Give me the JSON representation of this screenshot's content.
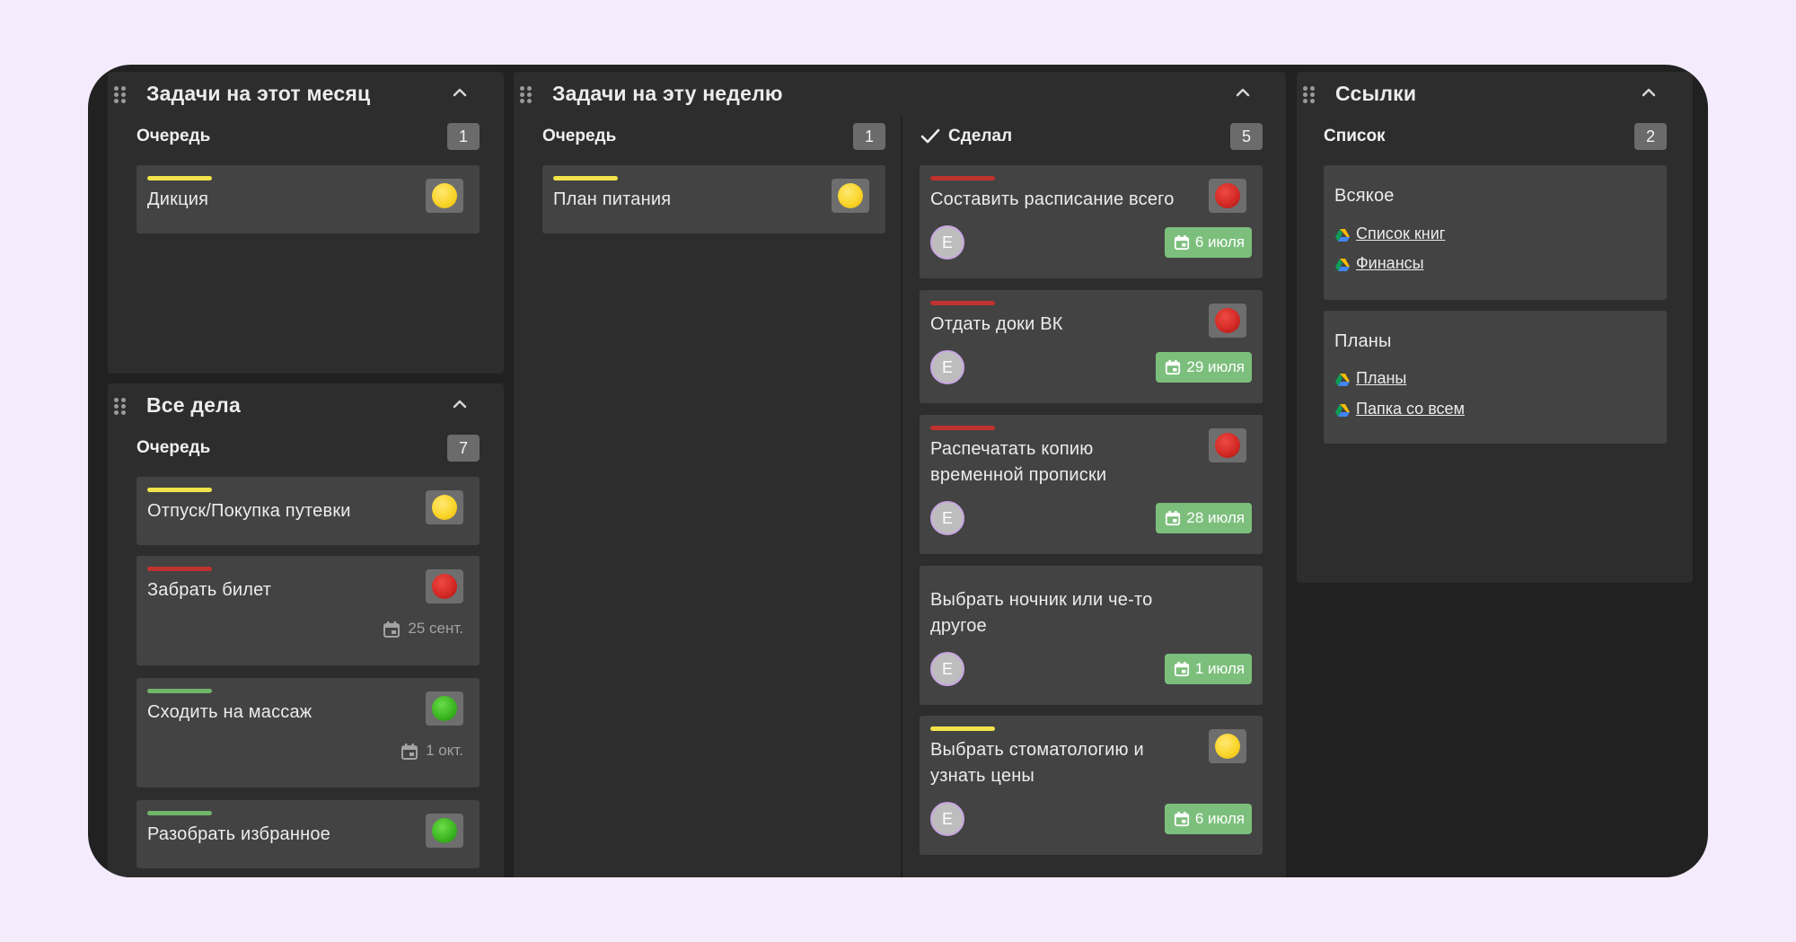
{
  "colors": {
    "page_bg": "#f4ecfd",
    "board_bg": "#212121",
    "panel_bg": "#2d2d2d",
    "card_bg": "#434343",
    "priority_yellow": "#f1e44a",
    "priority_red": "#c0322e",
    "priority_green": "#6fb66a",
    "date_badge_green": "#7cbf7c"
  },
  "panels": {
    "month": {
      "title": "Задачи на этот месяц",
      "column": {
        "title": "Очередь",
        "count": "1"
      },
      "cards": [
        {
          "title": "Дикция",
          "priority": "yellow"
        }
      ]
    },
    "all": {
      "title": "Все дела",
      "column": {
        "title": "Очередь",
        "count": "7"
      },
      "cards": [
        {
          "title": "Отпуск/Покупка путевки",
          "priority": "yellow"
        },
        {
          "title": "Забрать билет",
          "priority": "red",
          "date": "25 сент."
        },
        {
          "title": "Сходить на массаж",
          "priority": "green",
          "date": "1 окт."
        },
        {
          "title": "Разобрать избранное",
          "priority": "green"
        }
      ]
    },
    "week": {
      "title": "Задачи на эту неделю",
      "queue": {
        "title": "Очередь",
        "count": "1",
        "cards": [
          {
            "title": "План питания",
            "priority": "yellow"
          }
        ]
      },
      "done": {
        "title": "Сделал",
        "count": "5",
        "cards": [
          {
            "title": "Составить расписание всего",
            "priority": "red",
            "avatar": "E",
            "date": "6 июля"
          },
          {
            "title": "Отдать доки ВК",
            "priority": "red",
            "avatar": "E",
            "date": "29 июля"
          },
          {
            "title_line1": "Распечатать копию",
            "title_line2": "временной прописки",
            "priority": "red",
            "avatar": "E",
            "date": "28 июля"
          },
          {
            "title_line1": "Выбрать ночник или че-то",
            "title_line2": "другое",
            "priority": "none",
            "avatar": "E",
            "date": "1 июля"
          },
          {
            "title_line1": "Выбрать стоматологию и",
            "title_line2": "узнать цены",
            "priority": "yellow",
            "avatar": "E",
            "date": "6 июля"
          }
        ]
      }
    },
    "links": {
      "title": "Ссылки",
      "column": {
        "title": "Список",
        "count": "2"
      },
      "cards": [
        {
          "title": "Всякое",
          "links": [
            "Список книг",
            "Финансы"
          ]
        },
        {
          "title": "Планы",
          "links": [
            "Планы",
            "Папка со всем"
          ]
        }
      ]
    }
  }
}
